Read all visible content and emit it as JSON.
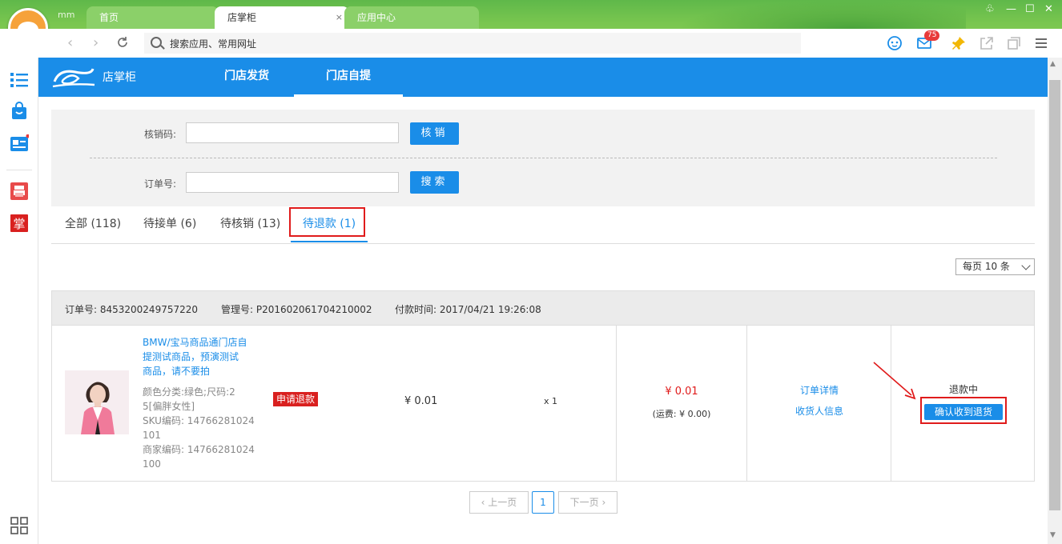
{
  "browser": {
    "username": "mm",
    "tabs": [
      {
        "label": "首页"
      },
      {
        "label": "店掌柜"
      },
      {
        "label": "应用中心"
      }
    ],
    "tab_close": "×",
    "address_placeholder": "搜索应用、常用网址",
    "mail_badge": "75"
  },
  "app": {
    "name": "店掌柜",
    "nav": [
      {
        "label": "门店发货"
      },
      {
        "label": "门店自提"
      }
    ]
  },
  "filters": {
    "verify_label": "核销码:",
    "verify_button": "核销",
    "order_label": "订单号:",
    "search_button": "搜索"
  },
  "status_tabs": [
    {
      "label": "全部 (118)"
    },
    {
      "label": "待接单 (6)"
    },
    {
      "label": "待核销 (13)"
    },
    {
      "label": "待退款 (1)"
    }
  ],
  "per_page": "每页 10 条",
  "order": {
    "order_no": "订单号: 8453200249757220",
    "manage_no": "管理号: P201602061704210002",
    "paid_time": "付款时间: 2017/04/21 19:26:08",
    "product_name_lines": [
      "BMW/宝马商品通门店自",
      "提测试商品，预演测试",
      "商品，请不要拍"
    ],
    "product_meta_lines": [
      "颜色分类:绿色;尺码:2",
      "5[偏胖女性]",
      "SKU编码: 14766281024",
      "101",
      "商家编码: 14766281024",
      "100"
    ],
    "refund_tag": "申请退款",
    "unit_price": "¥ 0.01",
    "quantity": "x 1",
    "total": "¥ 0.01",
    "shipping": "(运费: ¥ 0.00)",
    "detail_link": "订单详情",
    "receiver_link": "收货人信息",
    "status": "退款中",
    "confirm_button": "确认收到退货"
  },
  "pager": {
    "prev": "上一页",
    "current": "1",
    "next": "下一页"
  },
  "colors": {
    "primary": "#1a8de8",
    "highlight": "#e01b1b",
    "chrome_green": "#79c64f"
  }
}
